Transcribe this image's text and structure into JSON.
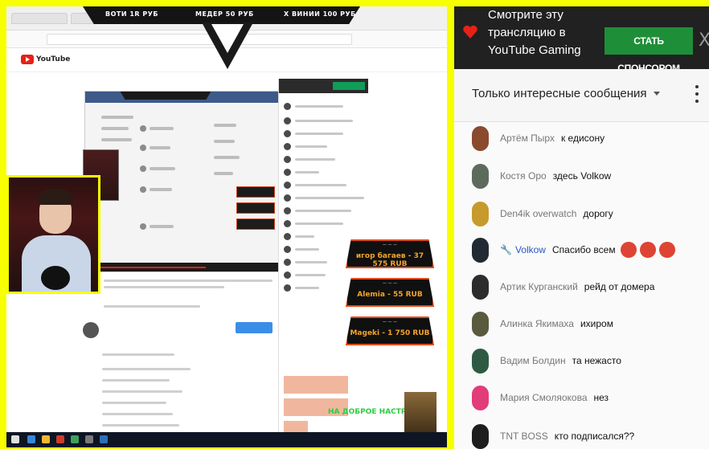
{
  "stream_capture": {
    "donation_banner": {
      "left_label": "ВОТИ 1R РУБ",
      "center_label": "МЕДЕР 50 РУБ",
      "right_label": "Х ВИНИИ 100 РУБ"
    },
    "youtube": {
      "logo_text": "YouTube"
    },
    "donation_goals": [
      {
        "value": "игор багаев - 37 575 RUB"
      },
      {
        "value": "Alemia - 55 RUB"
      },
      {
        "value": "Mageki - 1 750 RUB"
      }
    ],
    "overlay_text": "НА ДОБРОЕ НАСТРО"
  },
  "chat": {
    "sponsor": {
      "text_line1": "Смотрите эту",
      "text_line2": "трансляцию в",
      "text_line3": "YouTube Gaming",
      "button_label": "СТАТЬ СПОНСОРОМ",
      "close_glyph": "X",
      "accent_color": "#e62117",
      "button_color": "#1e8f38"
    },
    "filter": {
      "label": "Только интересные сообщения"
    },
    "messages": [
      {
        "author": "Артём Пырх",
        "text": "к едисону",
        "avatar_color": "#8a4a2e",
        "is_owner": false
      },
      {
        "author": "Костя Оро",
        "text": "здесь Volkow",
        "avatar_color": "#5d6b5d",
        "is_owner": false
      },
      {
        "author": "Den4ik overwatch",
        "text": "дорогу",
        "avatar_color": "#c79a2c",
        "is_owner": false
      },
      {
        "author": "Volkow",
        "text": "Спасибо всем",
        "avatar_color": "#222a33",
        "is_owner": true,
        "emoji_count": 3
      },
      {
        "author": "Артик Курганский",
        "text": "рейд от домера",
        "avatar_color": "#2d2d2d",
        "is_owner": false
      },
      {
        "author": "Алинка Якимаха",
        "text": "ихиром",
        "avatar_color": "#5a5a3e",
        "is_owner": false
      },
      {
        "author": "Вадим Болдин",
        "text": "та нежасто",
        "avatar_color": "#2e5a44",
        "is_owner": false
      },
      {
        "author": "Мария Смоляокова",
        "text": "нез",
        "avatar_color": "#e23d78",
        "is_owner": false
      },
      {
        "author": "TNT BOSS",
        "text": "кто подписался??",
        "avatar_color": "#1e1e1e",
        "is_owner": false
      }
    ]
  }
}
